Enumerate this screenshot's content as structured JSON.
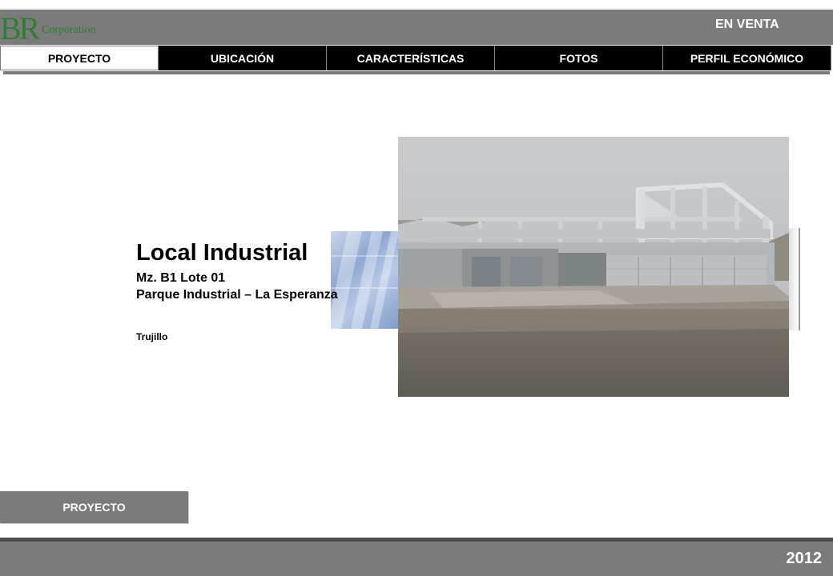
{
  "logo": {
    "mark": "BR",
    "text": "Corporation"
  },
  "header": {
    "status": "EN VENTA"
  },
  "tabs": [
    {
      "label": "PROYECTO",
      "active": true
    },
    {
      "label": "UBICACIÓN",
      "active": false
    },
    {
      "label": "CARACTERÍSTICAS",
      "active": false
    },
    {
      "label": "FOTOS",
      "active": false
    },
    {
      "label": "PERFIL ECONÓMICO",
      "active": false
    }
  ],
  "property": {
    "title": "Local Industrial",
    "lot": "Mz. B1 Lote  01",
    "park": "Parque Industrial – La Esperanza",
    "city": "Trujillo"
  },
  "section": {
    "label": "PROYECTO"
  },
  "footer": {
    "year": "2012"
  },
  "colors": {
    "brand_green": "#2e7d32",
    "bar_gray": "#7b7b7b",
    "tab_black": "#000000"
  }
}
